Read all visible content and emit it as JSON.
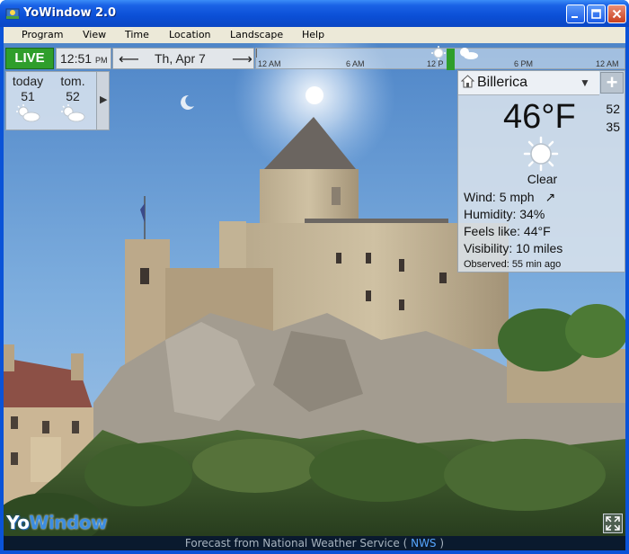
{
  "window": {
    "title": "YoWindow 2.0",
    "accent": "#0a53d8"
  },
  "menu": {
    "items": [
      "Program",
      "View",
      "Time",
      "Location",
      "Landscape",
      "Help"
    ]
  },
  "topbar": {
    "live_label": "LIVE",
    "time": "12:51",
    "ampm": "PM",
    "date": "Th, Apr 7",
    "timeline_labels": [
      "12 AM",
      "6 AM",
      "12 P",
      "6 PM",
      "12 AM"
    ]
  },
  "forecast": {
    "days": [
      {
        "label": "today",
        "temp": "51",
        "icon": "partly-sunny-icon"
      },
      {
        "label": "tom.",
        "temp": "52",
        "icon": "partly-sunny-icon"
      }
    ],
    "next_icon": "play-right-icon"
  },
  "current": {
    "location": "Billerica",
    "temperature": "46°F",
    "high": "52",
    "low": "35",
    "condition": "Clear",
    "condition_icon": "sun-icon",
    "wind_label": "Wind:",
    "wind_value": "5 mph",
    "humidity_label": "Humidity:",
    "humidity_value": "34%",
    "feels_label": "Feels like:",
    "feels_value": "44°F",
    "visibility_label": "Visibility:",
    "visibility_value": "10 miles",
    "observed_label": "Observed:",
    "observed_value": "55 min ago"
  },
  "footer": {
    "prefix": "Forecast from National Weather Service (",
    "link": "NWS",
    "suffix": ")"
  },
  "logo": {
    "yo": "Yo",
    "window": "Window"
  }
}
